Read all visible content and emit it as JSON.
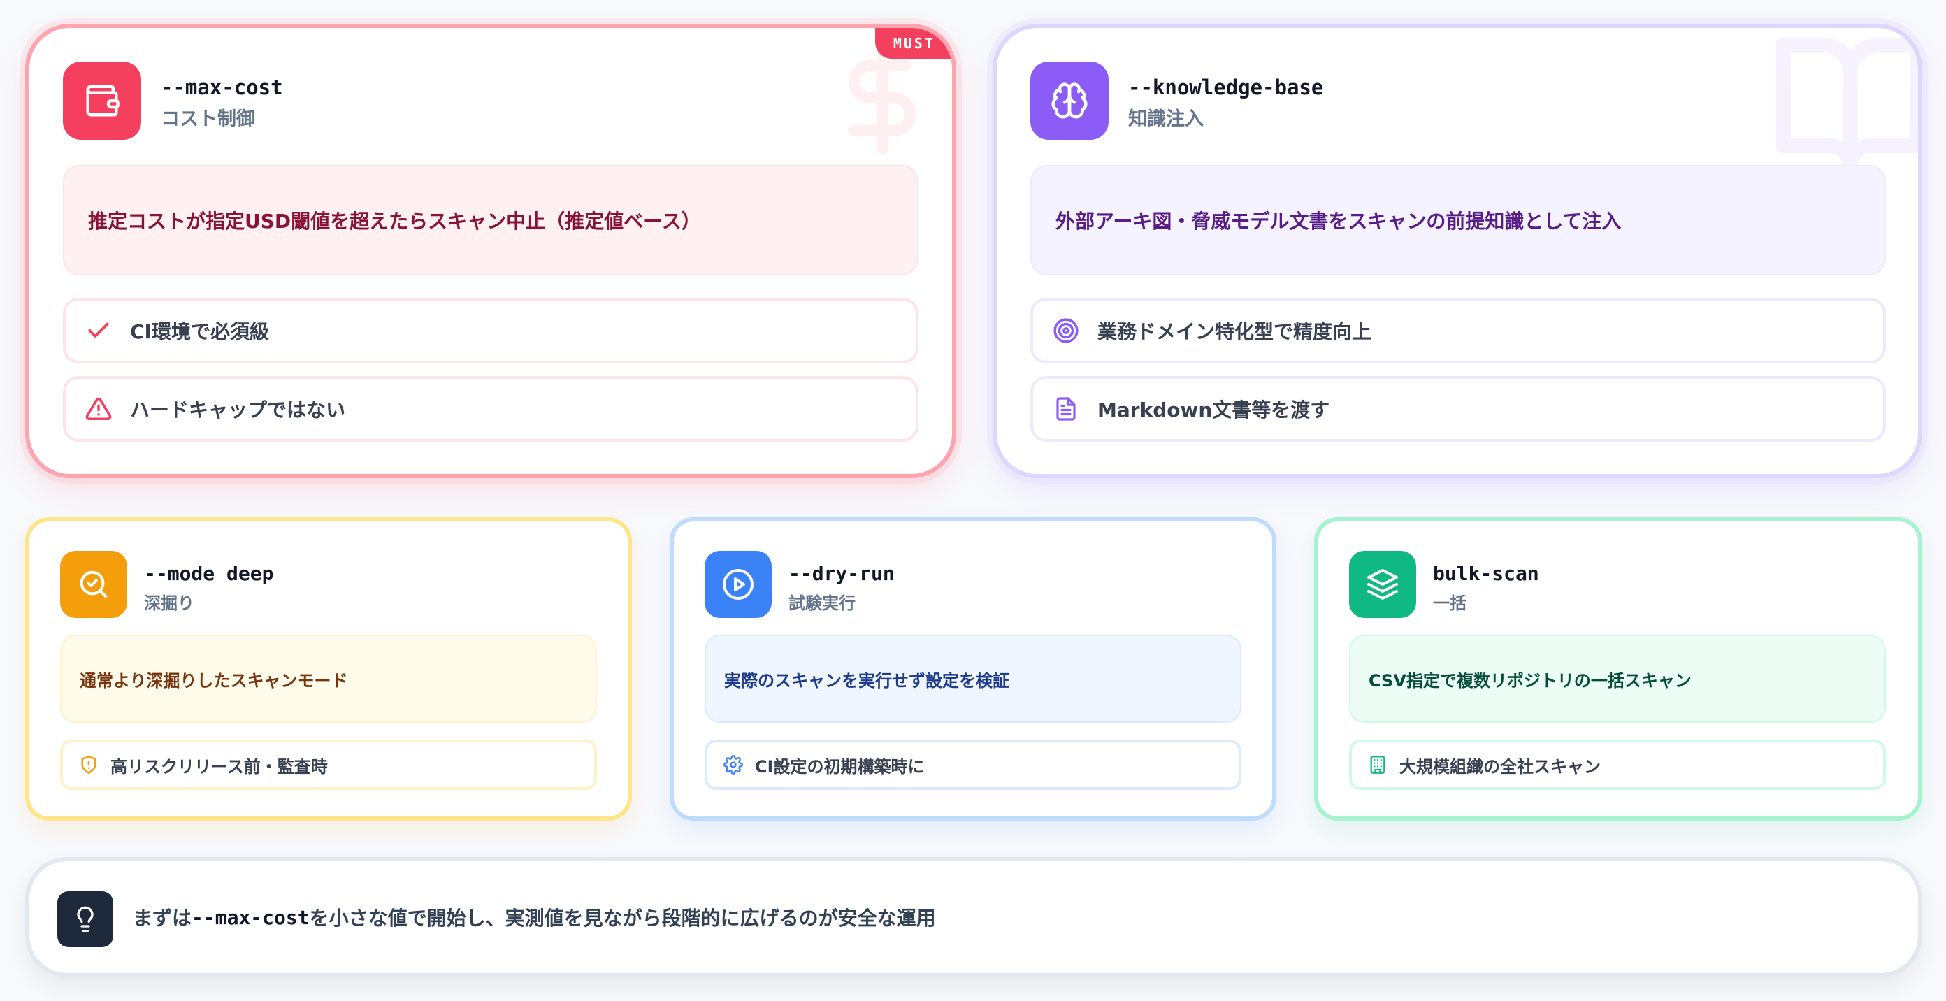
{
  "colors": {
    "cost_accent": "#f43f5e",
    "kb_accent": "#8b5cf6",
    "mode_accent": "#f59e0b",
    "dry_accent": "#3b82f6",
    "bulk_accent": "#10b981",
    "tip_accent": "#1e293b"
  },
  "cards": {
    "cost": {
      "badge": "MUST",
      "flag": "--max-cost",
      "subtitle": "コスト制御",
      "description": "推定コストが指定USD閾値を超えたらスキャン中止（推定値ベース）",
      "items": [
        {
          "icon": "check-icon",
          "label": "CI環境で必須級"
        },
        {
          "icon": "warning-triangle-icon",
          "label": "ハードキャップではない"
        }
      ],
      "icon": "wallet-icon",
      "watermark_icon": "dollar-sign-icon"
    },
    "knowledge": {
      "flag": "--knowledge-base",
      "subtitle": "知識注入",
      "description": "外部アーキ図・脅威モデル文書をスキャンの前提知識として注入",
      "items": [
        {
          "icon": "target-icon",
          "label": "業務ドメイン特化型で精度向上"
        },
        {
          "icon": "document-icon",
          "label": "Markdown文書等を渡す"
        }
      ],
      "icon": "brain-icon",
      "watermark_icon": "book-icon"
    },
    "mode": {
      "flag": "--mode deep",
      "subtitle": "深掘り",
      "description": "通常より深掘りしたスキャンモード",
      "item": {
        "icon": "shield-alert-icon",
        "label": "高リスクリリース前・監査時"
      },
      "icon": "search-check-icon"
    },
    "dry": {
      "flag": "--dry-run",
      "subtitle": "試験実行",
      "description": "実際のスキャンを実行せず設定を検証",
      "item": {
        "icon": "gear-icon",
        "label": "CI設定の初期構築時に"
      },
      "icon": "play-circle-icon"
    },
    "bulk": {
      "flag": "bulk-scan",
      "subtitle": "一括",
      "description": "CSV指定で複数リポジトリの一括スキャン",
      "item": {
        "icon": "building-icon",
        "label": "大規模組織の全社スキャン"
      },
      "icon": "layers-icon"
    }
  },
  "tip": {
    "icon": "lightbulb-icon",
    "prefix": "まずは",
    "code": "--max-cost",
    "suffix": "を小さな値で開始し、実測値を見ながら段階的に広げるのが安全な運用"
  }
}
